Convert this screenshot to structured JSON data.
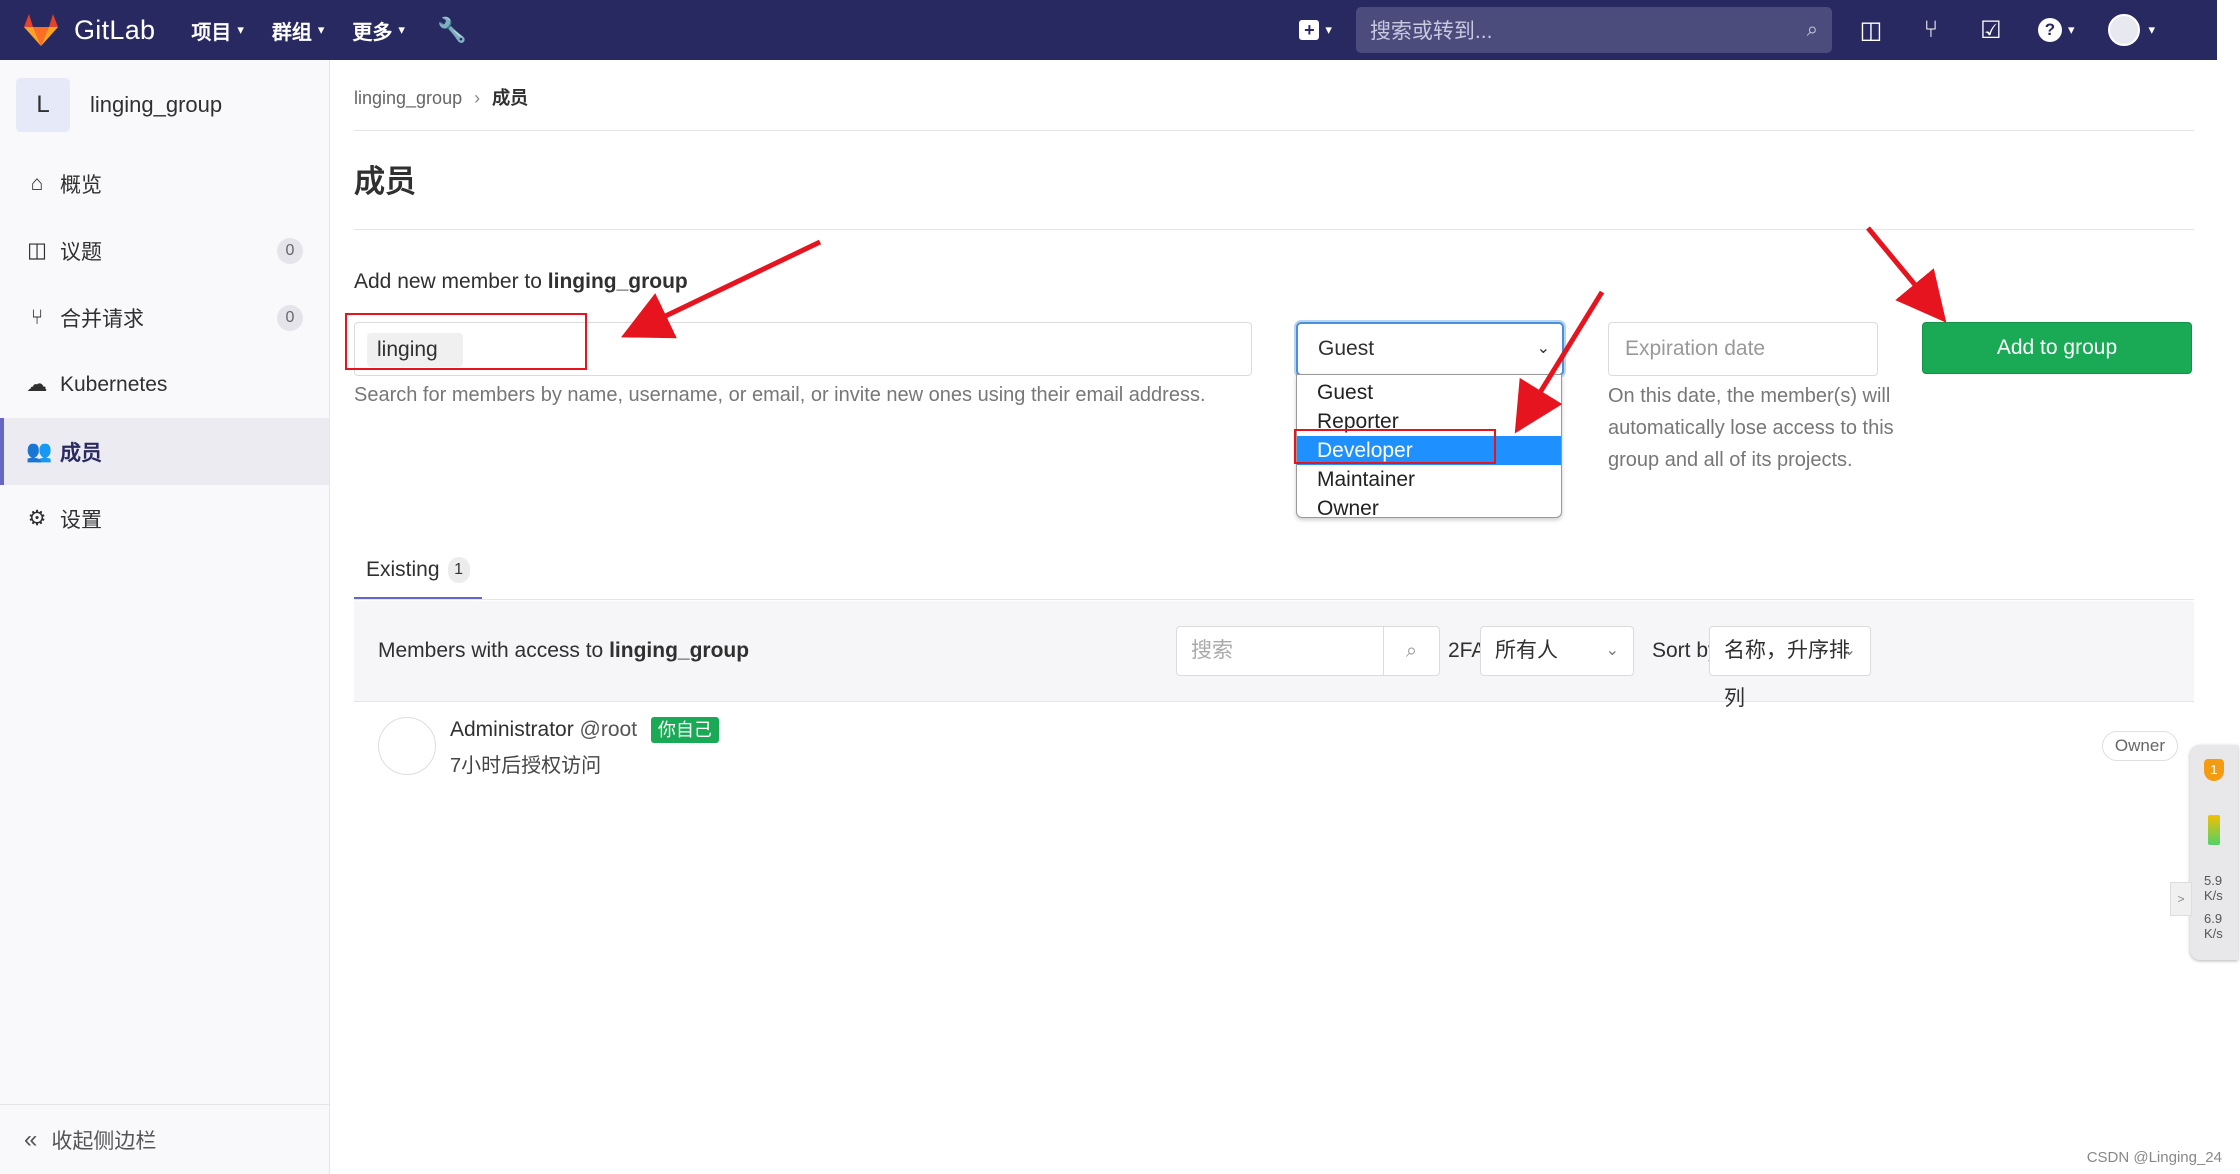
{
  "topbar": {
    "brand": "GitLab",
    "menu": [
      {
        "label": "项目"
      },
      {
        "label": "群组"
      },
      {
        "label": "更多"
      }
    ],
    "search_placeholder": "搜索或转到..."
  },
  "sidebar": {
    "group_initial": "L",
    "group_name": "linging_group",
    "items": [
      {
        "label": "概览"
      },
      {
        "label": "议题",
        "count": "0"
      },
      {
        "label": "合并请求",
        "count": "0"
      },
      {
        "label": "Kubernetes"
      },
      {
        "label": "成员"
      },
      {
        "label": "设置"
      }
    ],
    "collapse_label": "收起侧边栏"
  },
  "breadcrumb": {
    "parent": "linging_group",
    "current": "成员"
  },
  "page_title": "成员",
  "add_member": {
    "label_prefix": "Add new member to",
    "group": "linging_group",
    "token": "linging",
    "help": "Search for members by name, username, or email, or invite new ones using their email address.",
    "role_selected": "Guest",
    "role_options": [
      "Guest",
      "Reporter",
      "Developer",
      "Maintainer",
      "Owner"
    ],
    "role_highlighted": "Developer",
    "expiration_placeholder": "Expiration date",
    "expiration_help": "On this date, the member(s) will automatically lose access to this group and all of its projects.",
    "add_button": "Add to group"
  },
  "tabs": {
    "existing_label": "Existing",
    "existing_count": "1"
  },
  "members_panel": {
    "label_prefix": "Members with access to",
    "group": "linging_group",
    "search_placeholder": "搜索",
    "twofa_label": "2FA",
    "twofa_filter": "所有人",
    "sort_label": "Sort by",
    "sort_value": "名称，升序排列"
  },
  "members": [
    {
      "name": "Administrator",
      "username": "@root",
      "badge": "你自己",
      "granted": "7小时后授权访问",
      "role": "Owner"
    }
  ],
  "widget": {
    "shield_count": "1",
    "up_speed": "5.9",
    "up_unit": "K/s",
    "down_speed": "6.9",
    "down_unit": "K/s"
  },
  "watermark": "CSDN @Linging_24",
  "colors": {
    "navbar": "#292961",
    "primary_green": "#1aaa55",
    "highlight_blue": "#1e90ff",
    "annotation_red": "#e5141e"
  }
}
